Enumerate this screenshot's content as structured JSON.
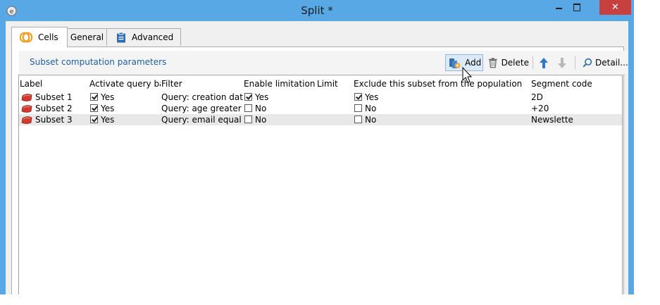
{
  "window": {
    "title": "Split *",
    "close_glyph": "✕",
    "icons": {
      "app": "app-logo-icon",
      "minimize": "minimize-icon",
      "maximize": "maximize-icon",
      "close": "close-icon"
    },
    "colors": {
      "frame": "#58a8e6",
      "close": "#c74040",
      "accent_text": "#1f5fa8"
    }
  },
  "tabs": [
    {
      "label": "Cells",
      "icon": "cells-icon",
      "active": true
    },
    {
      "label": "General",
      "active": false
    },
    {
      "label": "Advanced",
      "icon": "clipboard-icon",
      "active": false
    }
  ],
  "section": {
    "title": "Subset computation parameters",
    "toolbar": {
      "add": {
        "label": "Add",
        "icon": "add-icon"
      },
      "delete": {
        "label": "Delete",
        "icon": "trash-icon"
      },
      "move_up": {
        "icon": "arrow-up-icon"
      },
      "move_down": {
        "icon": "arrow-down-icon"
      },
      "detail": {
        "label": "Detail...",
        "icon": "search-icon"
      }
    }
  },
  "grid": {
    "columns": [
      "Label",
      "Activate query bas...",
      "Filter",
      "Enable limitation",
      "Limit",
      "Exclude this subset from the population",
      "Segment code"
    ],
    "rows": [
      {
        "label": "Subset 1",
        "activate_query": "Yes",
        "activate_checked": true,
        "filter": "Query: creation dat...",
        "enable_limitation": "Yes",
        "enable_checked": true,
        "limit": "",
        "exclude": "Yes",
        "exclude_checked": true,
        "segment_code": "2D",
        "selected": false
      },
      {
        "label": "Subset 2",
        "activate_query": "Yes",
        "activate_checked": true,
        "filter": "Query: age greater th...",
        "enable_limitation": "No",
        "enable_checked": false,
        "limit": "",
        "exclude": "No",
        "exclude_checked": false,
        "segment_code": "+20",
        "selected": false
      },
      {
        "label": "Subset 3",
        "activate_query": "Yes",
        "activate_checked": true,
        "filter": "Query: email equal t...",
        "enable_limitation": "No",
        "enable_checked": false,
        "limit": "",
        "exclude": "No",
        "exclude_checked": false,
        "segment_code": "Newslette",
        "selected": true
      }
    ]
  }
}
